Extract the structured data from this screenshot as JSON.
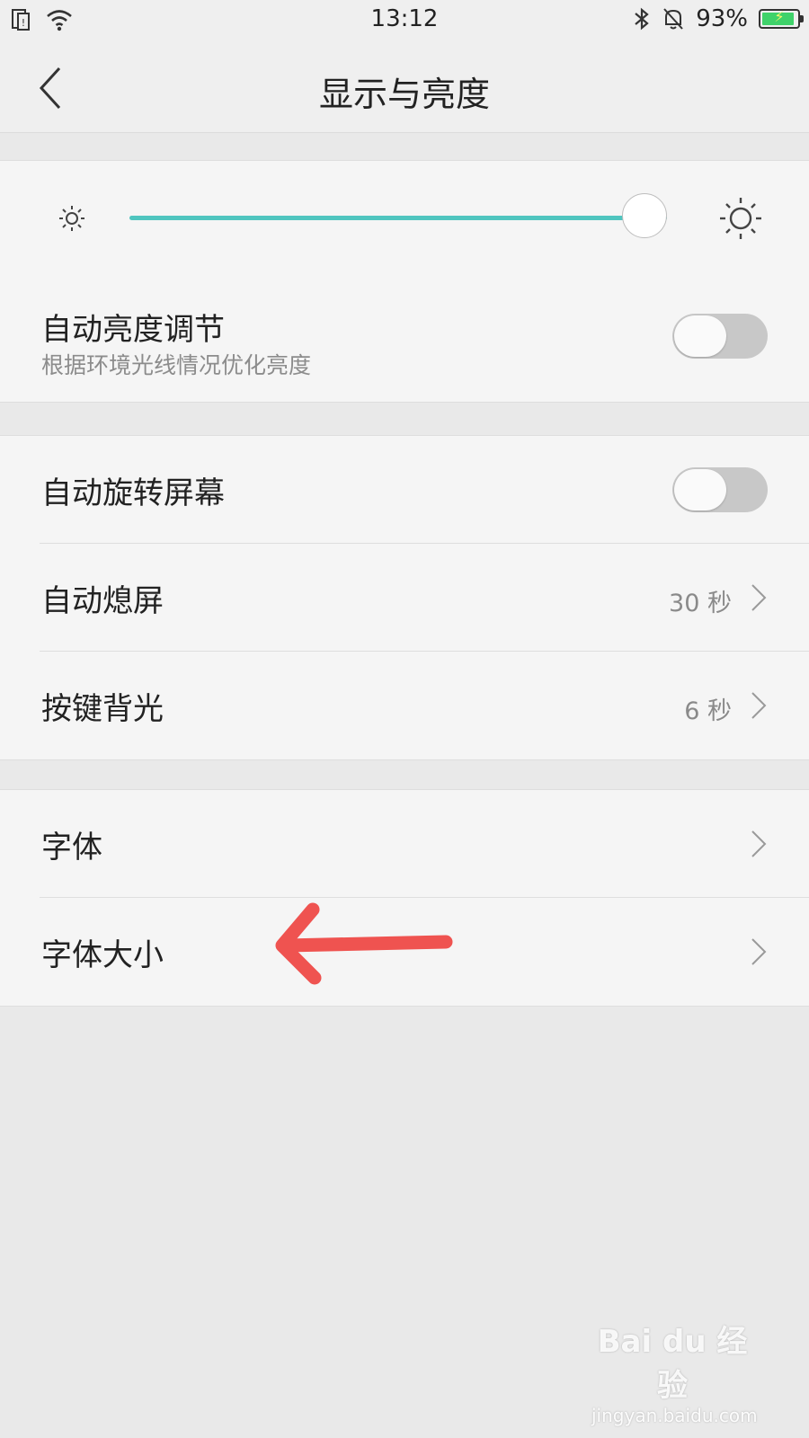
{
  "status_bar": {
    "time": "13:12",
    "battery_percent": "93%",
    "battery_level": 0.93,
    "icons": [
      "sim-icon",
      "wifi-icon",
      "bluetooth-icon",
      "silent-bell-icon",
      "battery-charging-icon"
    ]
  },
  "header": {
    "title": "显示与亮度",
    "back_icon": "back-chevron-icon"
  },
  "brightness": {
    "level": 0.94,
    "min_icon": "sun-small-icon",
    "max_icon": "sun-large-icon",
    "accent_color": "#4fc5bf",
    "auto_label": "自动亮度调节",
    "auto_sub": "根据环境光线情况优化亮度",
    "auto_on": false
  },
  "display": {
    "rotate_label": "自动旋转屏幕",
    "rotate_on": false,
    "sleep_label": "自动熄屏",
    "sleep_value": "30 秒",
    "backlight_label": "按键背光",
    "backlight_value": "6 秒"
  },
  "font": {
    "font_label": "字体",
    "size_label": "字体大小"
  },
  "annotation": {
    "color": "#ef5350"
  },
  "watermark": {
    "logo": "Bai du 经验",
    "sub": "jingyan.baidu.com"
  }
}
